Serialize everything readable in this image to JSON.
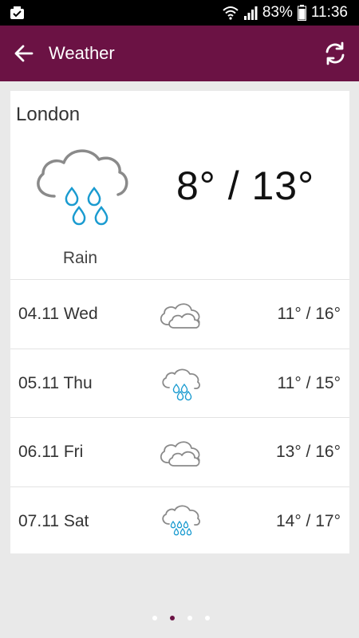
{
  "status_bar": {
    "battery_percent": "83%",
    "time": "11:36"
  },
  "app_bar": {
    "title": "Weather"
  },
  "current": {
    "city": "London",
    "condition": "Rain",
    "temperature": "8° / 13°",
    "icon": "rain-cloud-icon"
  },
  "forecast": [
    {
      "date": "04.11 Wed",
      "icon": "cloudy-icon",
      "temperature": "11° / 16°"
    },
    {
      "date": "05.11 Thu",
      "icon": "rain-cloud-icon",
      "temperature": "11° / 15°"
    },
    {
      "date": "06.11 Fri",
      "icon": "cloudy-icon",
      "temperature": "13° / 16°"
    },
    {
      "date": "07.11 Sat",
      "icon": "heavy-rain-cloud-icon",
      "temperature": "14° / 17°"
    }
  ],
  "pager": {
    "count": 4,
    "active_index": 1
  },
  "colors": {
    "accent": "#6b1244",
    "rain_drop": "#1a9bd0",
    "cloud_outline": "#8a8a8a",
    "background": "#e9e9e9"
  }
}
